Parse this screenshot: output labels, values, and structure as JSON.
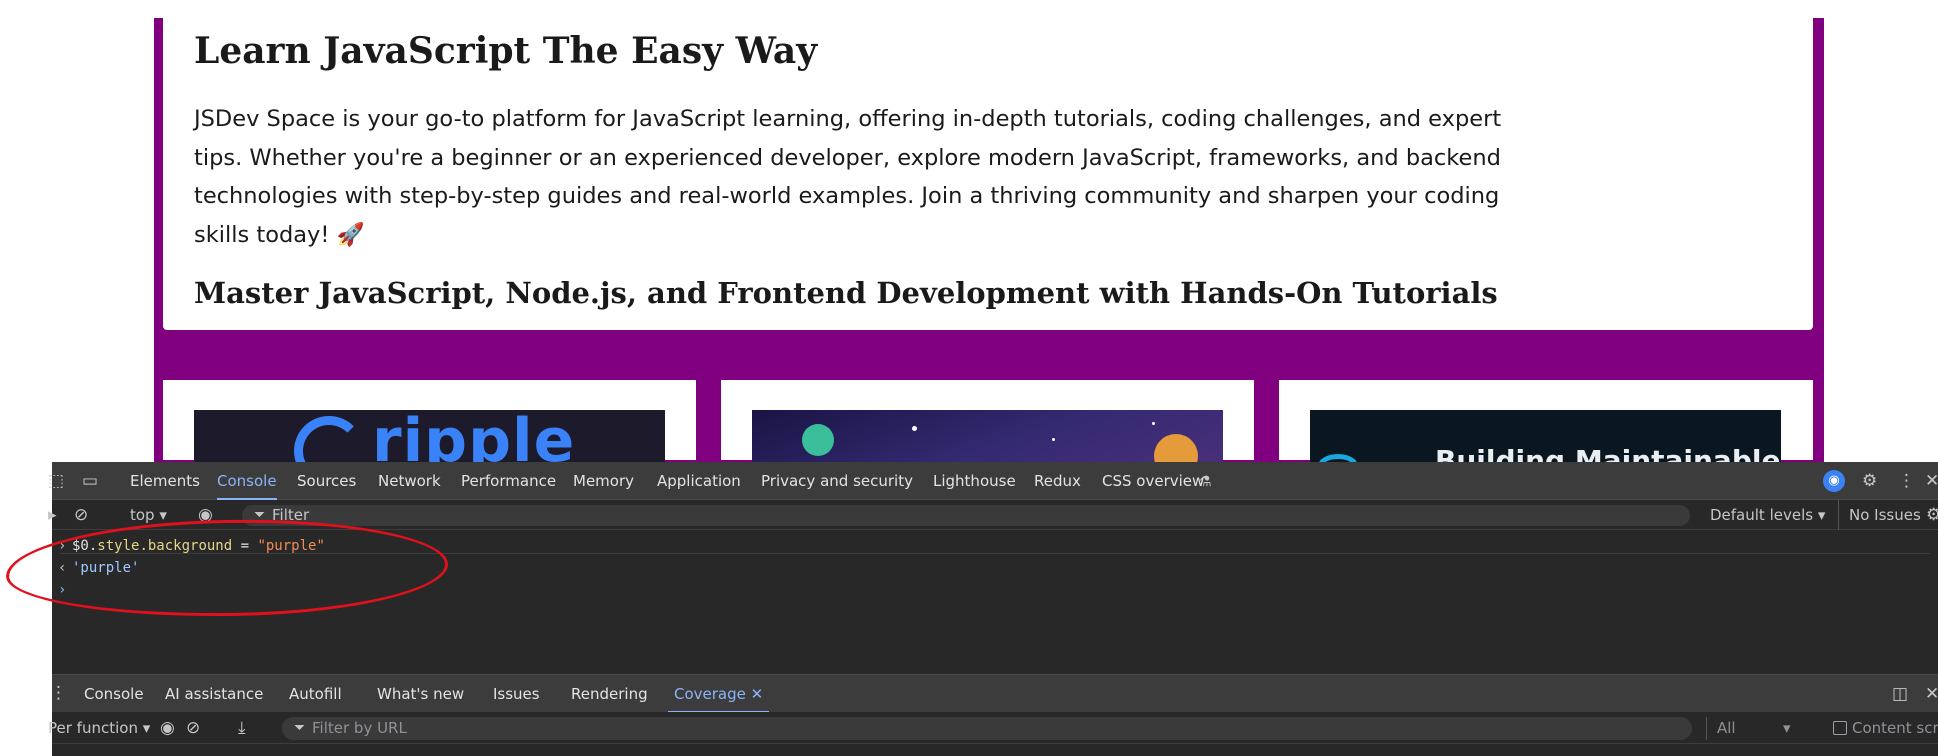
{
  "page": {
    "title": "Learn JavaScript The Easy Way",
    "description": "JSDev Space is your go-to platform for JavaScript learning, offering in-depth tutorials, coding challenges, and expert tips. Whether you're a beginner or an experienced developer, explore modern JavaScript, frameworks, and backend technologies with step-by-step guides and real-world examples. Join a thriving community and sharpen your coding skills today! 🚀",
    "subtitle": "Master JavaScript, Node.js, and Frontend Development with Hands-On Tutorials",
    "cards": [
      {
        "logo_text": "ripple"
      },
      {
        "logo_text": ""
      },
      {
        "logo_text": "Building Maintainable"
      }
    ],
    "colors": {
      "purple": "#800080"
    }
  },
  "devtools": {
    "tabs": [
      "Elements",
      "Console",
      "Sources",
      "Network",
      "Performance",
      "Memory",
      "Application",
      "Privacy and security",
      "Lighthouse",
      "Redux",
      "CSS overview"
    ],
    "active_tab": "Console",
    "context": "top",
    "filter_placeholder": "Filter",
    "levels": "Default levels",
    "issues": "No Issues",
    "console": {
      "input_command": {
        "prefix": "$0.",
        "prop": "style.background",
        "op": " = ",
        "value": "\"purple\""
      },
      "result": "'purple'",
      "prompt": "›"
    },
    "drawer_tabs": [
      "Console",
      "AI assistance",
      "Autofill",
      "What's new",
      "Issues",
      "Rendering",
      "Coverage"
    ],
    "drawer_active_tab": "Coverage",
    "coverage": {
      "mode": "Per function",
      "url_filter_placeholder": "Filter by URL",
      "type_select": "All",
      "content_scripts": "Content scrip"
    },
    "icons": {
      "inspect": "inspect-icon",
      "device": "device-toolbar-icon",
      "settings": "gear-icon",
      "more": "kebab-menu-icon",
      "close": "close-icon"
    },
    "colors": {
      "accent": "#8ab4f8",
      "annotation": "#e0101c"
    }
  }
}
